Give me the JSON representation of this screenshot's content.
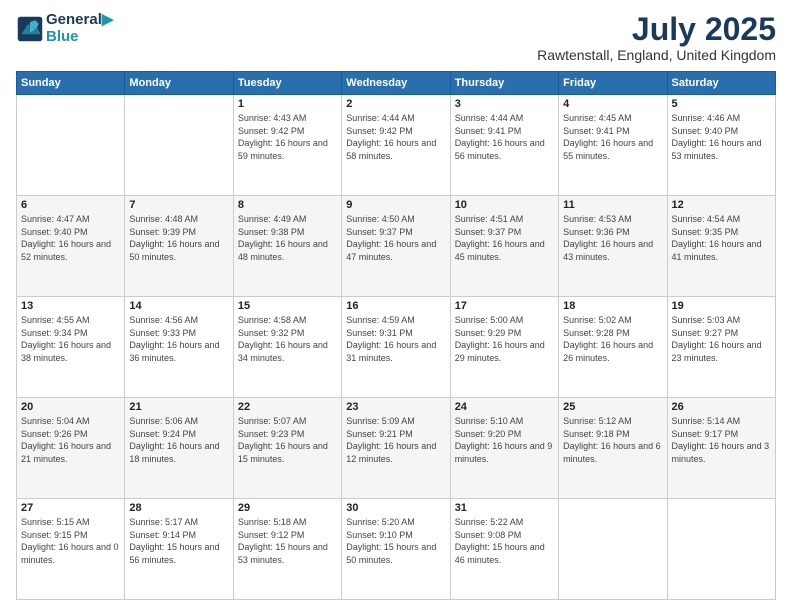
{
  "header": {
    "logo_line1": "General",
    "logo_line2": "Blue",
    "month_year": "July 2025",
    "location": "Rawtenstall, England, United Kingdom"
  },
  "weekdays": [
    "Sunday",
    "Monday",
    "Tuesday",
    "Wednesday",
    "Thursday",
    "Friday",
    "Saturday"
  ],
  "weeks": [
    [
      {
        "day": "",
        "sunrise": "",
        "sunset": "",
        "daylight": ""
      },
      {
        "day": "",
        "sunrise": "",
        "sunset": "",
        "daylight": ""
      },
      {
        "day": "1",
        "sunrise": "Sunrise: 4:43 AM",
        "sunset": "Sunset: 9:42 PM",
        "daylight": "Daylight: 16 hours and 59 minutes."
      },
      {
        "day": "2",
        "sunrise": "Sunrise: 4:44 AM",
        "sunset": "Sunset: 9:42 PM",
        "daylight": "Daylight: 16 hours and 58 minutes."
      },
      {
        "day": "3",
        "sunrise": "Sunrise: 4:44 AM",
        "sunset": "Sunset: 9:41 PM",
        "daylight": "Daylight: 16 hours and 56 minutes."
      },
      {
        "day": "4",
        "sunrise": "Sunrise: 4:45 AM",
        "sunset": "Sunset: 9:41 PM",
        "daylight": "Daylight: 16 hours and 55 minutes."
      },
      {
        "day": "5",
        "sunrise": "Sunrise: 4:46 AM",
        "sunset": "Sunset: 9:40 PM",
        "daylight": "Daylight: 16 hours and 53 minutes."
      }
    ],
    [
      {
        "day": "6",
        "sunrise": "Sunrise: 4:47 AM",
        "sunset": "Sunset: 9:40 PM",
        "daylight": "Daylight: 16 hours and 52 minutes."
      },
      {
        "day": "7",
        "sunrise": "Sunrise: 4:48 AM",
        "sunset": "Sunset: 9:39 PM",
        "daylight": "Daylight: 16 hours and 50 minutes."
      },
      {
        "day": "8",
        "sunrise": "Sunrise: 4:49 AM",
        "sunset": "Sunset: 9:38 PM",
        "daylight": "Daylight: 16 hours and 48 minutes."
      },
      {
        "day": "9",
        "sunrise": "Sunrise: 4:50 AM",
        "sunset": "Sunset: 9:37 PM",
        "daylight": "Daylight: 16 hours and 47 minutes."
      },
      {
        "day": "10",
        "sunrise": "Sunrise: 4:51 AM",
        "sunset": "Sunset: 9:37 PM",
        "daylight": "Daylight: 16 hours and 45 minutes."
      },
      {
        "day": "11",
        "sunrise": "Sunrise: 4:53 AM",
        "sunset": "Sunset: 9:36 PM",
        "daylight": "Daylight: 16 hours and 43 minutes."
      },
      {
        "day": "12",
        "sunrise": "Sunrise: 4:54 AM",
        "sunset": "Sunset: 9:35 PM",
        "daylight": "Daylight: 16 hours and 41 minutes."
      }
    ],
    [
      {
        "day": "13",
        "sunrise": "Sunrise: 4:55 AM",
        "sunset": "Sunset: 9:34 PM",
        "daylight": "Daylight: 16 hours and 38 minutes."
      },
      {
        "day": "14",
        "sunrise": "Sunrise: 4:56 AM",
        "sunset": "Sunset: 9:33 PM",
        "daylight": "Daylight: 16 hours and 36 minutes."
      },
      {
        "day": "15",
        "sunrise": "Sunrise: 4:58 AM",
        "sunset": "Sunset: 9:32 PM",
        "daylight": "Daylight: 16 hours and 34 minutes."
      },
      {
        "day": "16",
        "sunrise": "Sunrise: 4:59 AM",
        "sunset": "Sunset: 9:31 PM",
        "daylight": "Daylight: 16 hours and 31 minutes."
      },
      {
        "day": "17",
        "sunrise": "Sunrise: 5:00 AM",
        "sunset": "Sunset: 9:29 PM",
        "daylight": "Daylight: 16 hours and 29 minutes."
      },
      {
        "day": "18",
        "sunrise": "Sunrise: 5:02 AM",
        "sunset": "Sunset: 9:28 PM",
        "daylight": "Daylight: 16 hours and 26 minutes."
      },
      {
        "day": "19",
        "sunrise": "Sunrise: 5:03 AM",
        "sunset": "Sunset: 9:27 PM",
        "daylight": "Daylight: 16 hours and 23 minutes."
      }
    ],
    [
      {
        "day": "20",
        "sunrise": "Sunrise: 5:04 AM",
        "sunset": "Sunset: 9:26 PM",
        "daylight": "Daylight: 16 hours and 21 minutes."
      },
      {
        "day": "21",
        "sunrise": "Sunrise: 5:06 AM",
        "sunset": "Sunset: 9:24 PM",
        "daylight": "Daylight: 16 hours and 18 minutes."
      },
      {
        "day": "22",
        "sunrise": "Sunrise: 5:07 AM",
        "sunset": "Sunset: 9:23 PM",
        "daylight": "Daylight: 16 hours and 15 minutes."
      },
      {
        "day": "23",
        "sunrise": "Sunrise: 5:09 AM",
        "sunset": "Sunset: 9:21 PM",
        "daylight": "Daylight: 16 hours and 12 minutes."
      },
      {
        "day": "24",
        "sunrise": "Sunrise: 5:10 AM",
        "sunset": "Sunset: 9:20 PM",
        "daylight": "Daylight: 16 hours and 9 minutes."
      },
      {
        "day": "25",
        "sunrise": "Sunrise: 5:12 AM",
        "sunset": "Sunset: 9:18 PM",
        "daylight": "Daylight: 16 hours and 6 minutes."
      },
      {
        "day": "26",
        "sunrise": "Sunrise: 5:14 AM",
        "sunset": "Sunset: 9:17 PM",
        "daylight": "Daylight: 16 hours and 3 minutes."
      }
    ],
    [
      {
        "day": "27",
        "sunrise": "Sunrise: 5:15 AM",
        "sunset": "Sunset: 9:15 PM",
        "daylight": "Daylight: 16 hours and 0 minutes."
      },
      {
        "day": "28",
        "sunrise": "Sunrise: 5:17 AM",
        "sunset": "Sunset: 9:14 PM",
        "daylight": "Daylight: 15 hours and 56 minutes."
      },
      {
        "day": "29",
        "sunrise": "Sunrise: 5:18 AM",
        "sunset": "Sunset: 9:12 PM",
        "daylight": "Daylight: 15 hours and 53 minutes."
      },
      {
        "day": "30",
        "sunrise": "Sunrise: 5:20 AM",
        "sunset": "Sunset: 9:10 PM",
        "daylight": "Daylight: 15 hours and 50 minutes."
      },
      {
        "day": "31",
        "sunrise": "Sunrise: 5:22 AM",
        "sunset": "Sunset: 9:08 PM",
        "daylight": "Daylight: 15 hours and 46 minutes."
      },
      {
        "day": "",
        "sunrise": "",
        "sunset": "",
        "daylight": ""
      },
      {
        "day": "",
        "sunrise": "",
        "sunset": "",
        "daylight": ""
      }
    ]
  ]
}
